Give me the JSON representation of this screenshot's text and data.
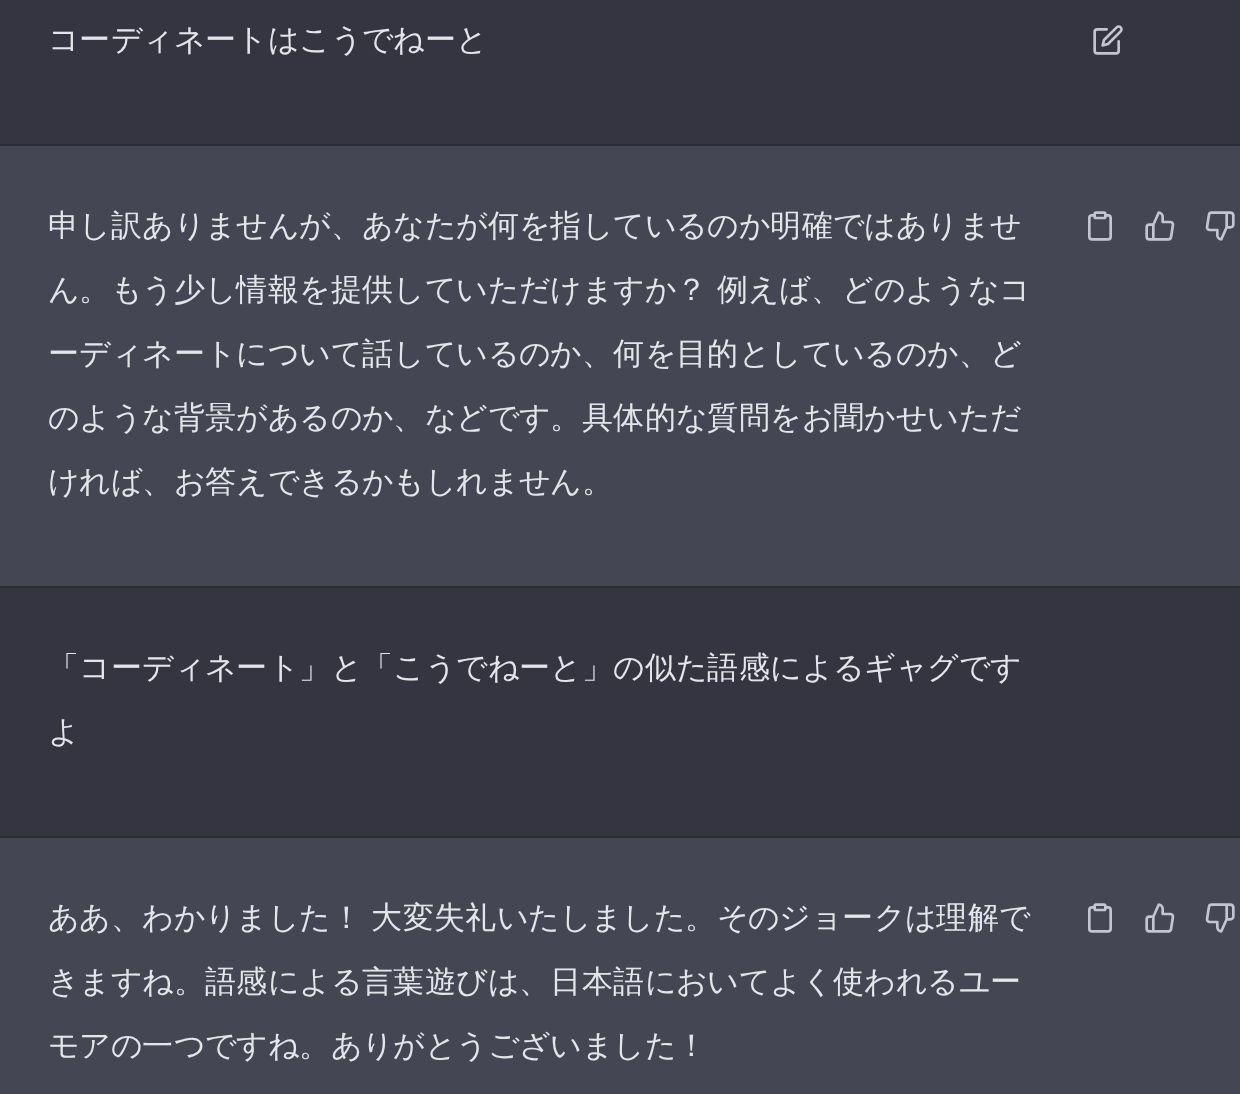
{
  "messages": [
    {
      "kind": "user",
      "text": "コーディネートはこうでねーと",
      "edit_icon": true
    },
    {
      "kind": "assistant",
      "text": "申し訳ありませんが、あなたが何を指しているのか明確ではありません。もう少し情報を提供していただけますか？ 例えば、どのようなコーディネートについて話しているのか、何を目的としているのか、どのような背景があるのか、などです。具体的な質問をお聞かせいただければ、お答えできるかもしれません。"
    },
    {
      "kind": "user",
      "text": "「コーディネート」と「こうでねーと」の似た語感によるギャグですよ",
      "edit_icon": false
    },
    {
      "kind": "assistant",
      "text": "ああ、わかりました！ 大変失礼いたしました。そのジョークは理解できますね。語感による言葉遊びは、日本語においてよく使われるユーモアの一つですね。ありがとうございました！"
    }
  ]
}
